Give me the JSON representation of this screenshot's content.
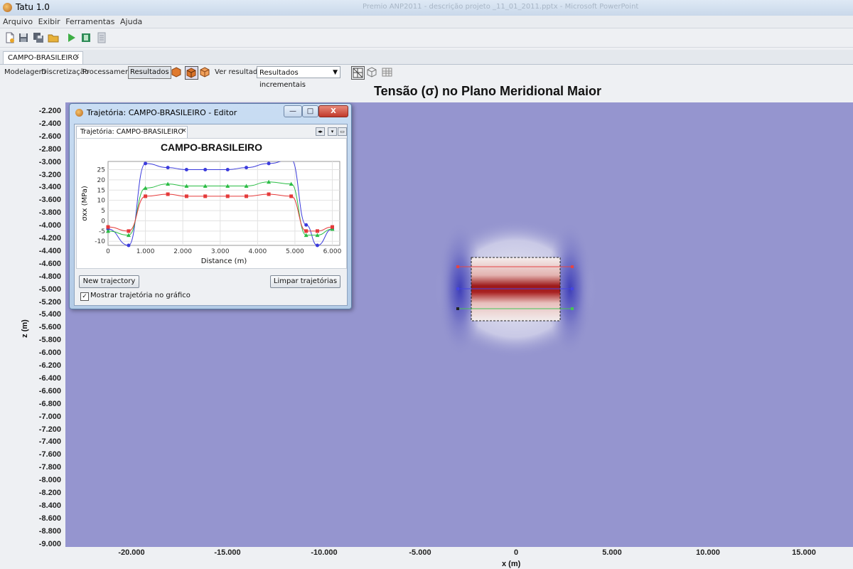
{
  "window": {
    "title": "Tatu 1.0",
    "background_caption": "Premio ANP2011 - descrição projeto _11_01_2011.pptx - Microsoft PowerPoint"
  },
  "menu": [
    "Arquivo",
    "Exibir",
    "Ferramentas",
    "Ajuda"
  ],
  "tab": {
    "label": "CAMPO-BRASILEIRO",
    "close": "×"
  },
  "view": {
    "modes": [
      "Modelagem",
      "Discretização",
      "Processamento",
      "Resultados"
    ],
    "active_mode": "Resultados",
    "result_label": "Ver resultado:",
    "result_value": "Resultados incrementais"
  },
  "plot": {
    "title": "Tensão (σ) no Plano Meridional Maior",
    "y_ticks": [
      "-2.200",
      "-2.400",
      "-2.600",
      "-2.800",
      "-3.000",
      "-3.200",
      "-3.400",
      "-3.600",
      "-3.800",
      "-4.000",
      "-4.200",
      "-4.400",
      "-4.600",
      "-4.800",
      "-5.000",
      "-5.200",
      "-5.400",
      "-5.600",
      "-5.800",
      "-6.000",
      "-6.200",
      "-6.400",
      "-6.600",
      "-6.800",
      "-7.000",
      "-7.200",
      "-7.400",
      "-7.600",
      "-7.800",
      "-8.000",
      "-8.200",
      "-8.400",
      "-8.600",
      "-8.800",
      "-9.000"
    ],
    "x_ticks": [
      "-20.000",
      "-15.000",
      "-10.000",
      "-5.000",
      "0",
      "5.000",
      "10.000",
      "15.000"
    ],
    "y_title": "z (m)",
    "x_title": "x (m)"
  },
  "editor": {
    "title": "Trajetória: CAMPO-BRASILEIRO - Editor",
    "tab": "Trajetória: CAMPO-BRASILEIRO",
    "tab_close": "×",
    "buttons": {
      "minimize": "—",
      "maximize": "□",
      "close": "X",
      "new": "New trajectory",
      "clear": "Limpar trajetórias"
    },
    "checkbox": {
      "label": "Mostrar trajetória no gráfico",
      "checked": "✓"
    }
  },
  "chart_data": {
    "type": "line",
    "title": "CAMPO-BRASILEIRO",
    "xlabel": "Distance (m)",
    "ylabel": "σxx (MPa)",
    "xlim": [
      0,
      6.2
    ],
    "ylim": [
      -12,
      29
    ],
    "x_ticks": [
      "0",
      "1.000",
      "2.000",
      "3.000",
      "4.000",
      "5.000",
      "6.000"
    ],
    "y_ticks": [
      "25",
      "20",
      "15",
      "10",
      "5",
      "0",
      "-5",
      "-10"
    ],
    "series": [
      {
        "color": "#3b3bdc",
        "marker": "circle",
        "x": [
          0,
          0.55,
          1.0,
          1.6,
          2.1,
          2.6,
          3.2,
          3.7,
          4.3,
          4.9,
          5.3,
          5.6,
          6.0
        ],
        "values": [
          -4,
          -12,
          28,
          26,
          25,
          25,
          25,
          26,
          28,
          30,
          -2,
          -12,
          -4
        ]
      },
      {
        "color": "#2bbd45",
        "marker": "triangle",
        "x": [
          0,
          0.55,
          1.0,
          1.6,
          2.1,
          2.6,
          3.2,
          3.7,
          4.3,
          4.9,
          5.3,
          5.6,
          6.0
        ],
        "values": [
          -5,
          -7,
          16,
          18,
          17,
          17,
          17,
          17,
          19,
          18,
          -7,
          -7,
          -4
        ]
      },
      {
        "color": "#e53a3a",
        "marker": "square",
        "x": [
          0,
          0.55,
          1.0,
          1.6,
          2.1,
          2.6,
          3.2,
          3.7,
          4.3,
          4.9,
          5.3,
          5.6,
          6.0
        ],
        "values": [
          -3,
          -5,
          12,
          13,
          12,
          12,
          12,
          12,
          13,
          12,
          -5,
          -5,
          -3
        ]
      }
    ]
  }
}
